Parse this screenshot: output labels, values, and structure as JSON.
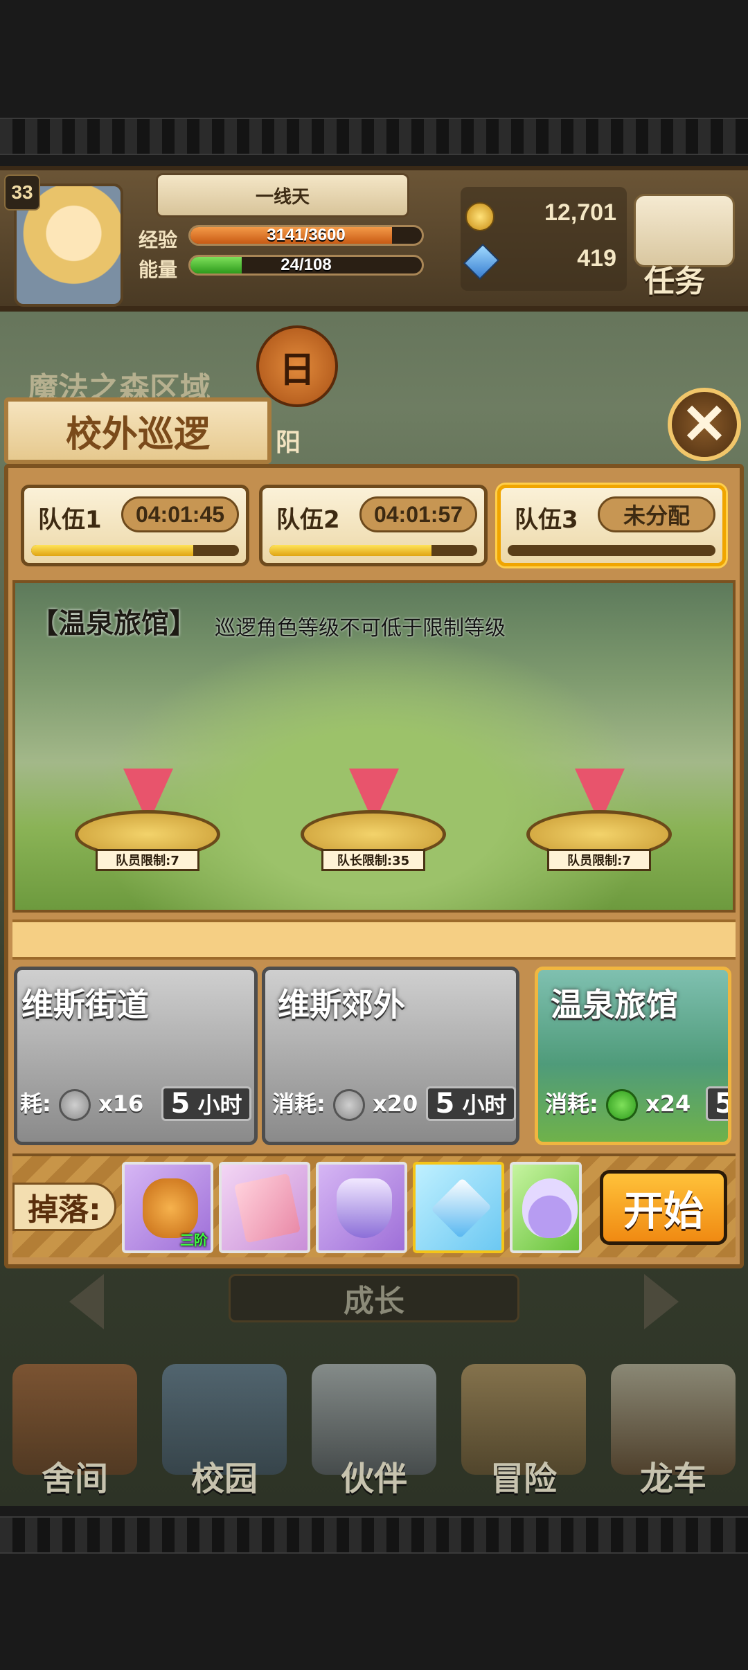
{
  "hud": {
    "level": "33",
    "stage_name": "一线天",
    "exp_label": "经验",
    "exp_value": "3141/3600",
    "exp_progress": 0.8725,
    "energy_label": "能量",
    "energy_value": "24/108",
    "energy_progress": 0.2222,
    "coins": "12,701",
    "gems": "419",
    "task_label": "任务",
    "day_label": "日",
    "region_label": "魔法之森区域",
    "sun_label": "阳"
  },
  "modal": {
    "title": "校外巡逻",
    "close_symbol": "✕",
    "teams": [
      {
        "name": "队伍1",
        "timer": "04:01:45",
        "progress": 0.78
      },
      {
        "name": "队伍2",
        "timer": "04:01:57",
        "progress": 0.78
      },
      {
        "name": "队伍3",
        "timer": "未分配",
        "progress": 0.0
      }
    ],
    "scene": {
      "title": "【温泉旅馆】",
      "subtitle": "巡逻角色等级不可低于限制等级",
      "slots": [
        "队员限制:7",
        "队长限制:35",
        "队员限制:7"
      ]
    },
    "locations": [
      {
        "name": "维斯街道",
        "cost_label": "耗:",
        "cost": "x16",
        "hours_num": "5",
        "hours_unit": "小时"
      },
      {
        "name": "维斯郊外",
        "cost_label": "消耗:",
        "cost": "x20",
        "hours_num": "5",
        "hours_unit": "小时"
      },
      {
        "name": "温泉旅馆",
        "cost_label": "消耗:",
        "cost": "x24",
        "hours_num": "5",
        "hours_unit": ""
      }
    ],
    "drops_label": "掉落:",
    "drops": [
      {
        "icon": "bag-icon",
        "tag": "三阶"
      },
      {
        "icon": "letter-icon",
        "tag": ""
      },
      {
        "icon": "crystal-icon",
        "tag": ""
      },
      {
        "icon": "diamond-card-icon",
        "tag": ""
      },
      {
        "icon": "potion-icon",
        "tag": ""
      }
    ],
    "start_label": "开始"
  },
  "bottom": {
    "growth_label": "成长",
    "nav": [
      "舍间",
      "校园",
      "伙伴",
      "冒险",
      "龙车"
    ]
  },
  "colors": {
    "accent": "#f08a12",
    "panel": "#c38f4f",
    "exp_fill": "#e07a2a",
    "energy_fill": "#4fbf3a"
  }
}
